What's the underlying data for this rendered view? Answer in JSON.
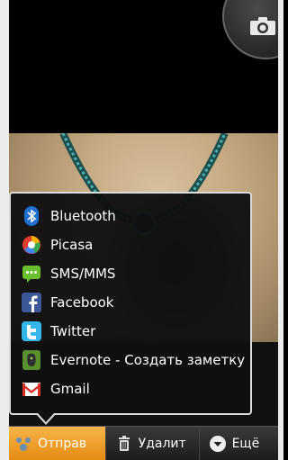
{
  "bottom_bar": {
    "share_label": "Отправ",
    "delete_label": "Удалит",
    "more_label": "Ещё"
  },
  "share_menu": {
    "items": [
      {
        "label": "Bluetooth",
        "icon": "bluetooth-icon"
      },
      {
        "label": "Picasa",
        "icon": "picasa-icon"
      },
      {
        "label": "SMS/MMS",
        "icon": "sms-icon"
      },
      {
        "label": "Facebook",
        "icon": "facebook-icon"
      },
      {
        "label": "Twitter",
        "icon": "twitter-icon"
      },
      {
        "label": "Evernote - Создать заметку",
        "icon": "evernote-icon"
      },
      {
        "label": "Gmail",
        "icon": "gmail-icon"
      }
    ]
  },
  "colors": {
    "accent": "#f0a020",
    "popup_border": "#dcdcdc"
  }
}
